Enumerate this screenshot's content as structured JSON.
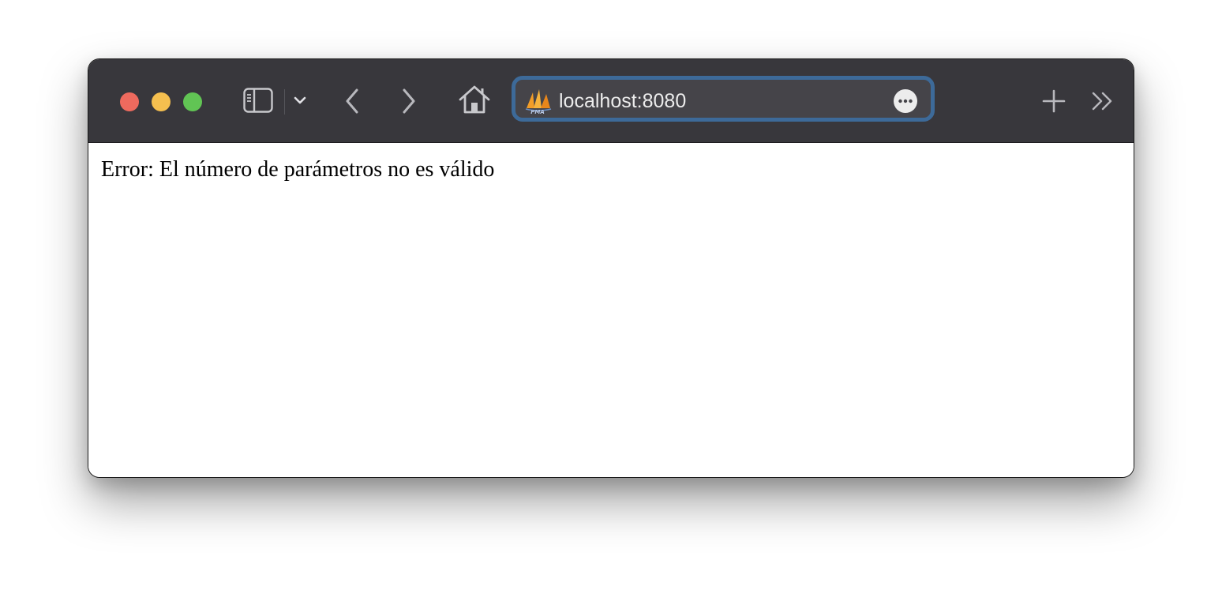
{
  "browser": {
    "address_bar": {
      "url": "localhost:8080",
      "site_icon": "phpmyadmin-sails-icon"
    },
    "toolbar_icons": [
      "sidebar-icon",
      "chevron-down-icon",
      "back-icon",
      "forward-icon",
      "home-icon",
      "more-icon",
      "new-tab-icon",
      "overflow-icon"
    ],
    "colors": {
      "toolbar": "#38373c",
      "urlbar_focus_ring": "#3d6a99",
      "close": "#ee6a5e",
      "minimize": "#f5bf4f",
      "zoom": "#61c454"
    }
  },
  "page": {
    "message": "Error: El número de parámetros no es válido"
  }
}
